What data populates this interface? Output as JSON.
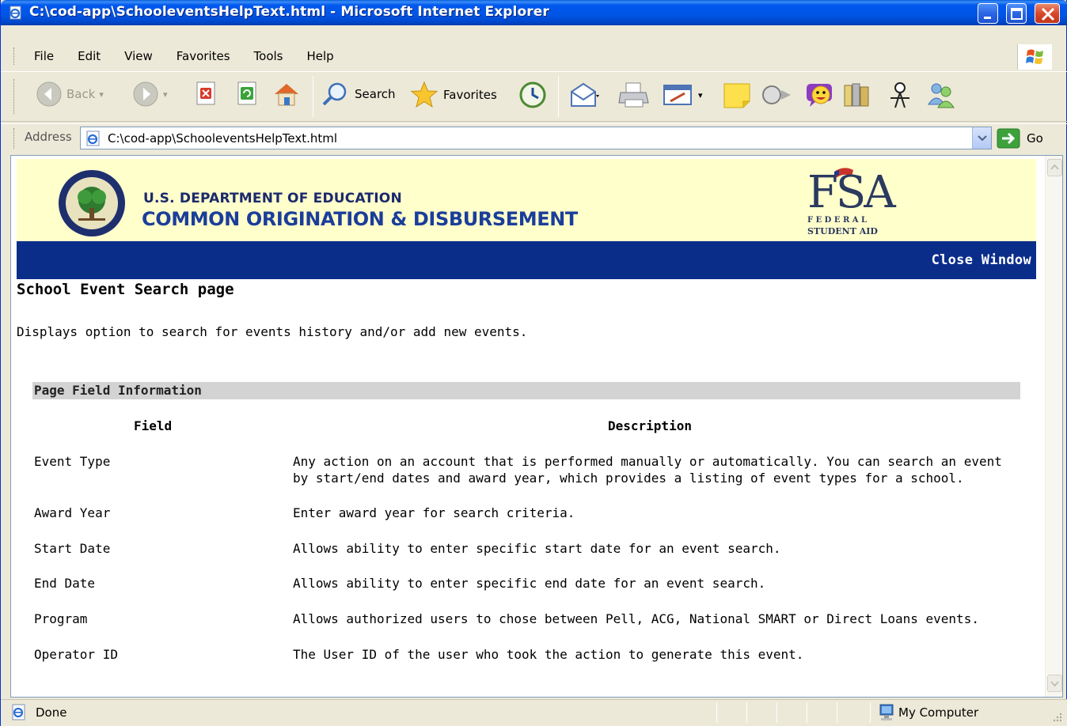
{
  "window": {
    "title": "C:\\cod-app\\SchooleventsHelpText.html - Microsoft Internet Explorer"
  },
  "menu": {
    "items": [
      "File",
      "Edit",
      "View",
      "Favorites",
      "Tools",
      "Help"
    ]
  },
  "toolbar": {
    "back_label": "Back",
    "search_label": "Search",
    "favorites_label": "Favorites"
  },
  "address": {
    "label": "Address",
    "url": "C:\\cod-app\\SchooleventsHelpText.html",
    "go_label": "Go"
  },
  "banner": {
    "department": "U.S. DEPARTMENT OF EDUCATION",
    "system": "COMMON ORIGINATION & DISBURSEMENT",
    "fsa_letters": "FSA",
    "fsa_federal": "F E D E R A L",
    "fsa_student_aid": "STUDENT AID",
    "close_window": "Close Window"
  },
  "page": {
    "title": "School Event Search page",
    "description": "Displays option to search for events history and/or add new events.",
    "section_title": "Page Field Information",
    "col_field": "Field",
    "col_description": "Description",
    "rows": [
      {
        "field": "Event Type",
        "description": "Any action on an account that is performed manually or automatically. You can search an event by start/end dates and award year, which provides a listing of event types for a school."
      },
      {
        "field": "Award Year",
        "description": "Enter award year for search criteria."
      },
      {
        "field": "Start Date",
        "description": "Allows ability to enter specific start date for an event search."
      },
      {
        "field": "End Date",
        "description": "Allows ability to enter specific end date for an event search."
      },
      {
        "field": "Program",
        "description": "Allows authorized users to chose between Pell, ACG, National SMART or Direct Loans events."
      },
      {
        "field": "Operator ID",
        "description": "The User ID of the user who took the action to generate this event."
      }
    ]
  },
  "status": {
    "text": "Done",
    "zone": "My Computer"
  },
  "colors": {
    "titlebar": "#0055E5",
    "banner_bg": "#FFFFCC",
    "nav_band": "#0B2D8A",
    "section_header": "#D3D3D3"
  }
}
